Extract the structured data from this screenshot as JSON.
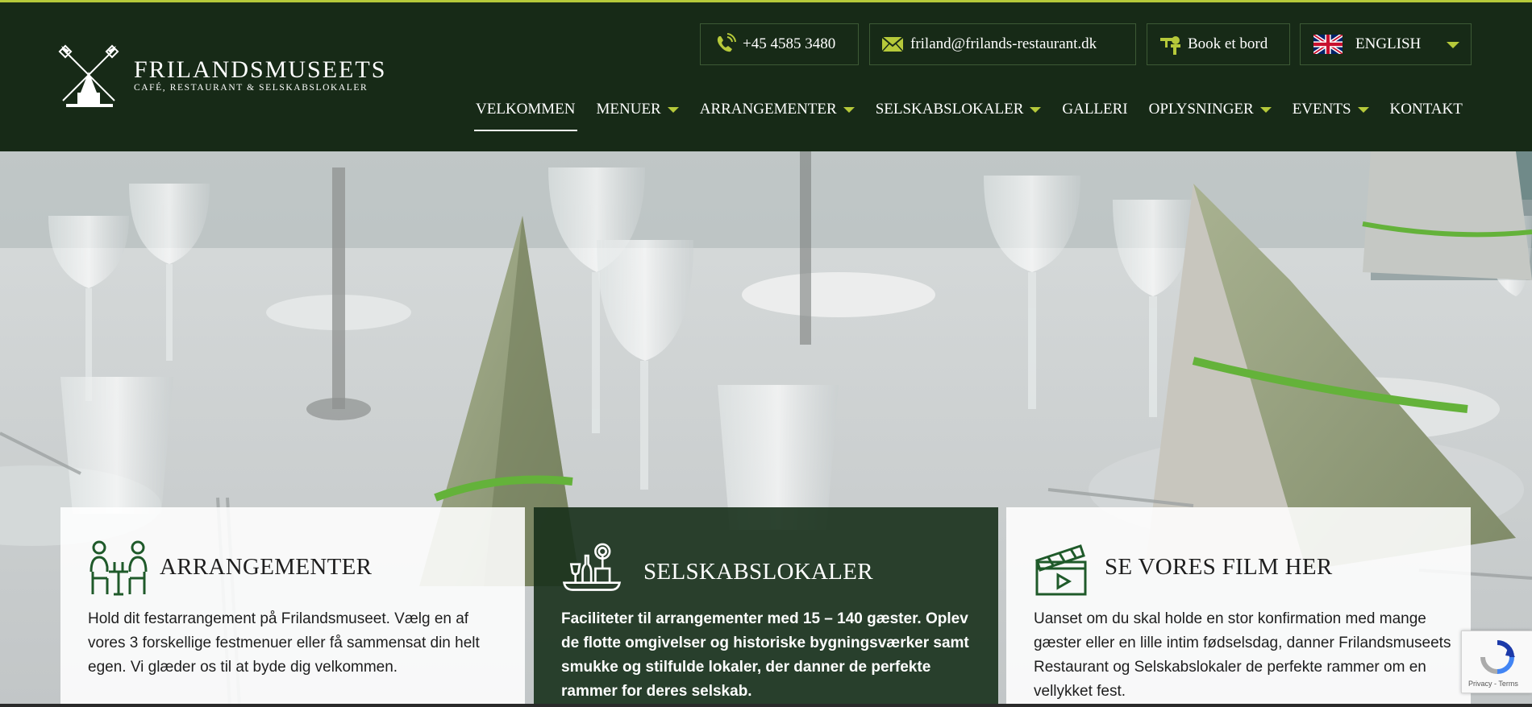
{
  "brand": {
    "title": "FRILANDSMUSEETS",
    "subtitle": "CAFÉ, RESTAURANT & SELSKABSLOKALER",
    "icon": "windmill-logo",
    "accent_color": "#b6c93a",
    "header_bg": "#172a17"
  },
  "topbar": {
    "phone": {
      "label": "+45 4585 3480",
      "icon": "phone-icon"
    },
    "email": {
      "label": "friland@frilands-restaurant.dk",
      "icon": "envelope-icon"
    },
    "book": {
      "label": "Book et bord",
      "icon": "waiter-icon"
    },
    "language": {
      "label": "ENGLISH",
      "icon": "uk-flag-icon"
    }
  },
  "nav": {
    "items": [
      {
        "label": "VELKOMMEN",
        "dropdown": false,
        "active": true
      },
      {
        "label": "MENUER",
        "dropdown": true
      },
      {
        "label": "ARRANGEMENTER",
        "dropdown": true
      },
      {
        "label": "SELSKABSLOKALER",
        "dropdown": true
      },
      {
        "label": "GALLERI",
        "dropdown": false
      },
      {
        "label": "OPLYSNINGER",
        "dropdown": true
      },
      {
        "label": "EVENTS",
        "dropdown": true
      },
      {
        "label": "KONTAKT",
        "dropdown": false
      }
    ]
  },
  "cards": [
    {
      "title": "ARRANGEMENTER",
      "icon": "dining-people-icon",
      "text": "Hold dit festarrangement på Frilandsmuseet. Vælg en af vores 3 forskellige festmenuer eller få sammensat din helt egen. Vi glæder os til at byde dig velkommen."
    },
    {
      "title": "SELSKABSLOKALER",
      "icon": "banquet-table-icon",
      "text": "Faciliteter til arrangementer med 15 – 140 gæster. Oplev de flotte omgivelser og historiske bygningsværker samt smukke og stilfulde lokaler, der danner de perfekte rammer for deres selskab."
    },
    {
      "title": "SE VORES FILM HER",
      "icon": "clapperboard-icon",
      "text": "Uanset om du skal holde en stor konfirmation med mange gæster eller en lille intim fødselsdag, danner Frilandsmuseets Restaurant og Selskabslokaler de perfekte rammer om en vellykket fest."
    }
  ],
  "recaptcha": {
    "label": "Privacy - Terms",
    "icon": "recaptcha-icon"
  }
}
